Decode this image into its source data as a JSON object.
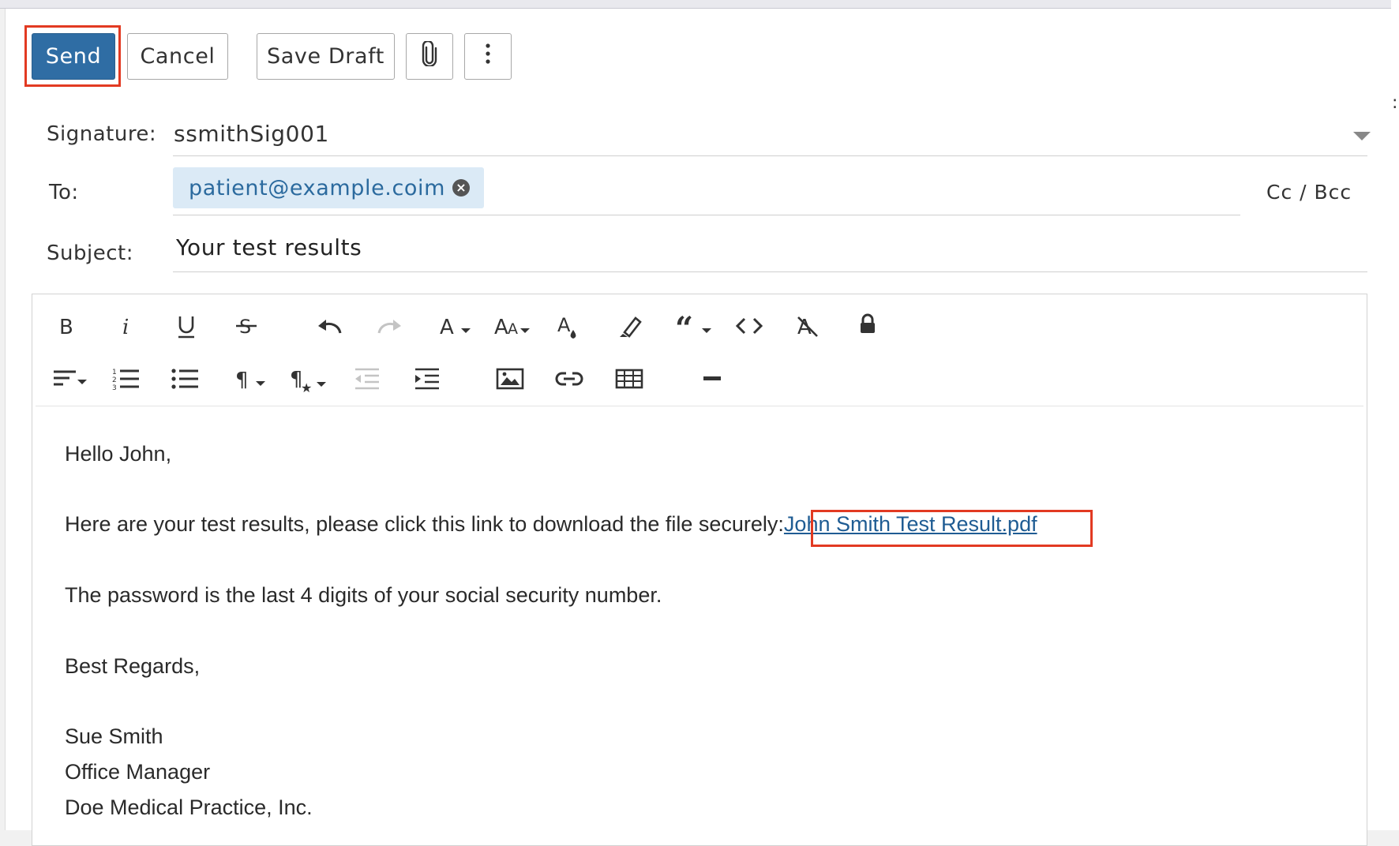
{
  "toolbar": {
    "send_label": "Send",
    "cancel_label": "Cancel",
    "save_draft_label": "Save Draft"
  },
  "form": {
    "signature_label": "Signature:",
    "signature_value": "ssmithSig001",
    "to_label": "To:",
    "to_recipients": [
      "patient@example.coim"
    ],
    "cc_bcc_label": "Cc / Bcc",
    "subject_label": "Subject:",
    "subject_value": "Your test results"
  },
  "editor": {
    "toolbar_row1": [
      "bold-icon",
      "italic-icon",
      "underline-icon",
      "strikethrough-icon",
      "undo-icon",
      "redo-icon",
      "font-family-icon",
      "font-size-icon",
      "text-color-icon",
      "highlight-icon",
      "quote-icon",
      "code-icon",
      "clear-format-icon",
      "lock-icon"
    ],
    "toolbar_row2": [
      "align-icon",
      "ordered-list-icon",
      "unordered-list-icon",
      "paragraph-format-icon",
      "paragraph-style-icon",
      "outdent-icon",
      "indent-icon",
      "insert-image-icon",
      "insert-link-icon",
      "insert-table-icon",
      "horizontal-line-icon"
    ],
    "body": {
      "greeting": "Hello John,",
      "line1_text": "Here are your test results, please click this link to download the file securely:",
      "line1_link": "John Smith Test Result.pdf",
      "line2": "The password is the last 4 digits of your social security number.",
      "closing": "Best Regards,",
      "sig_name": "Sue Smith",
      "sig_title": "Office Manager",
      "sig_company": "Doe Medical Practice, Inc."
    }
  },
  "colors": {
    "primary": "#2f6da4",
    "highlight_border": "#e23a22",
    "chip_bg": "#dbeaf6",
    "link": "#1f5c93"
  }
}
